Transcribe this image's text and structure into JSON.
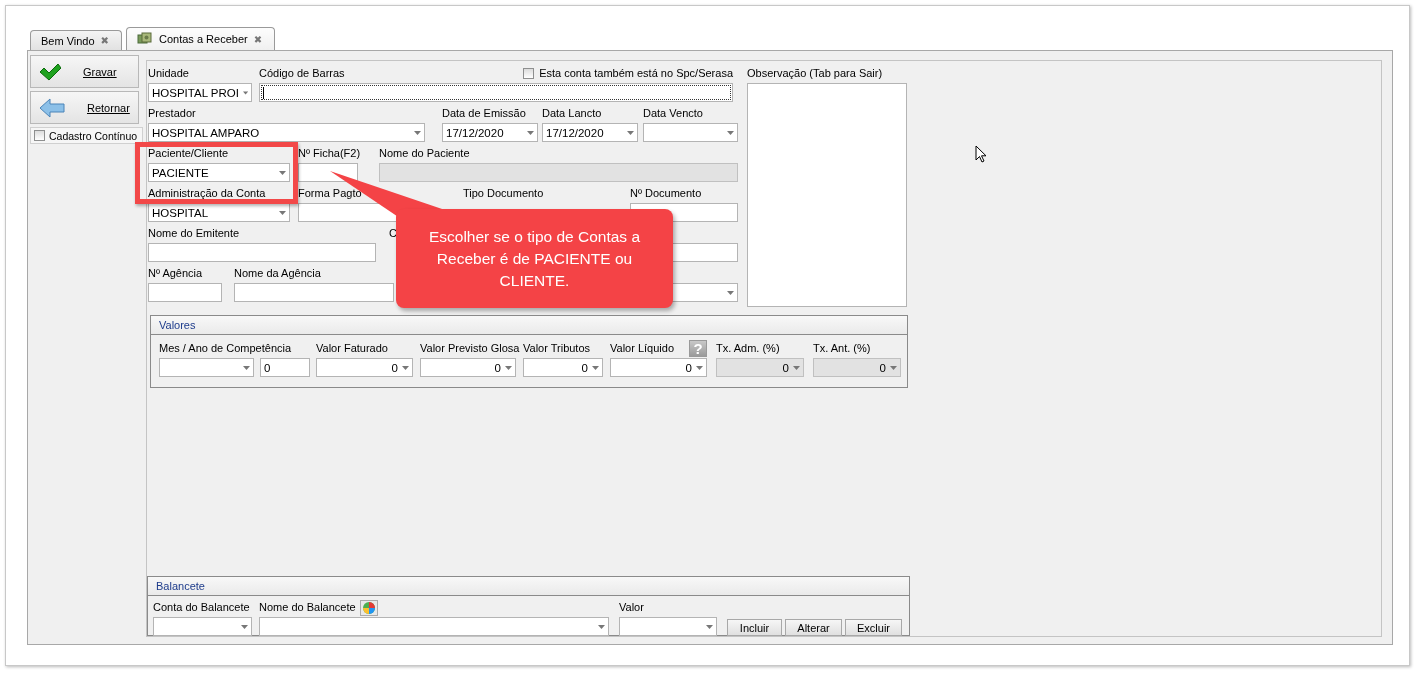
{
  "tabs": [
    {
      "label": "Bem Vindo",
      "close": "✖",
      "selected": false,
      "icon": false
    },
    {
      "label": "Contas a Receber",
      "close": "✖",
      "selected": true,
      "icon": true
    }
  ],
  "toolbar": {
    "buttons": [
      {
        "label": "Gravar",
        "kind": "save"
      },
      {
        "label": "Retornar",
        "kind": "back"
      }
    ],
    "continuous": {
      "label": "Cadastro Contínuo",
      "checked": false
    }
  },
  "form": {
    "spc_check": {
      "label": "Esta conta também está no Spc/Serasa",
      "checked": false
    },
    "rows": [
      [
        {
          "label": "Unidade",
          "kind": "combo",
          "value": "HOSPITAL PROI",
          "disabled": false,
          "focused": false
        },
        {
          "label": "Código de Barras",
          "kind": "text",
          "disabled": false,
          "focused": true
        }
      ],
      [
        {
          "label": "Prestador",
          "kind": "combo",
          "value": "HOSPITAL AMPARO",
          "disabled": false,
          "focused": false
        },
        {
          "label": "Data de Emissão",
          "kind": "combo",
          "value": "17/12/2020",
          "disabled": false,
          "focused": false
        },
        {
          "label": "Data Lancto",
          "kind": "combo",
          "value": "17/12/2020",
          "disabled": false,
          "focused": false
        },
        {
          "label": "Data Vencto",
          "kind": "combo",
          "disabled": false,
          "focused": false
        }
      ],
      [
        {
          "label": "Paciente/Cliente",
          "kind": "combo",
          "value": "PACIENTE",
          "disabled": false,
          "focused": false
        },
        {
          "label": "Nº Ficha(F2)",
          "kind": "text",
          "disabled": false,
          "focused": false
        },
        {
          "label": "Nome do Paciente",
          "kind": "text",
          "disabled": true,
          "focused": false
        }
      ],
      [
        {
          "label": "Administração da Conta",
          "kind": "combo",
          "value": "HOSPITAL",
          "disabled": false,
          "focused": false
        },
        {
          "label": "Forma Pagto",
          "kind": "text",
          "disabled": false,
          "focused": false
        },
        {
          "label": "Tipo Documento",
          "kind": "label"
        },
        {
          "label": "Nº Documento",
          "kind": "text",
          "disabled": false,
          "focused": false
        }
      ],
      [
        {
          "label": "Nome do Emitente",
          "kind": "text",
          "disabled": false,
          "focused": false
        },
        {
          "label": "C",
          "kind": "label"
        },
        {
          "kind": "text",
          "disabled": false,
          "focused": false
        }
      ],
      [
        {
          "label": "Nº Agência",
          "kind": "text",
          "disabled": false,
          "focused": false
        },
        {
          "label": "Nome da Agência",
          "kind": "text",
          "disabled": false,
          "focused": false
        },
        {
          "kind": "combo",
          "disabled": false,
          "focused": false
        }
      ]
    ],
    "observation": {
      "label": "Observação (Tab para Sair)"
    }
  },
  "valores": {
    "title": "Valores",
    "help": "?",
    "fields": [
      {
        "label": "Mes / Ano de Competência",
        "kind": "combo",
        "disabled": false
      },
      {
        "kind": "text",
        "value": "0",
        "disabled": false
      },
      {
        "label": "Valor Faturado",
        "kind": "number",
        "value": "0",
        "disabled": false
      },
      {
        "label": "Valor Previsto Glosa",
        "kind": "number",
        "value": "0",
        "disabled": false
      },
      {
        "label": "Valor Tributos",
        "kind": "number",
        "value": "0",
        "disabled": false
      },
      {
        "label": "Valor Líquido",
        "kind": "number",
        "value": "0",
        "disabled": false
      },
      {
        "label": "Tx. Adm. (%)",
        "kind": "number",
        "value": "0",
        "disabled": true
      },
      {
        "label": "Tx. Ant. (%)",
        "kind": "number",
        "value": "0",
        "disabled": true
      }
    ]
  },
  "balancete": {
    "title": "Balancete",
    "fields": [
      {
        "label": "Conta do Balancete",
        "kind": "combo"
      },
      {
        "label": "Nome do Balancete",
        "kind": "combo"
      },
      {
        "label": "Valor",
        "kind": "combo"
      }
    ],
    "buttons": [
      "Incluir",
      "Alterar",
      "Excluir"
    ]
  },
  "callout": {
    "text": "Escolher se o tipo de Contas a Receber é de PACIENTE ou CLIENTE."
  }
}
